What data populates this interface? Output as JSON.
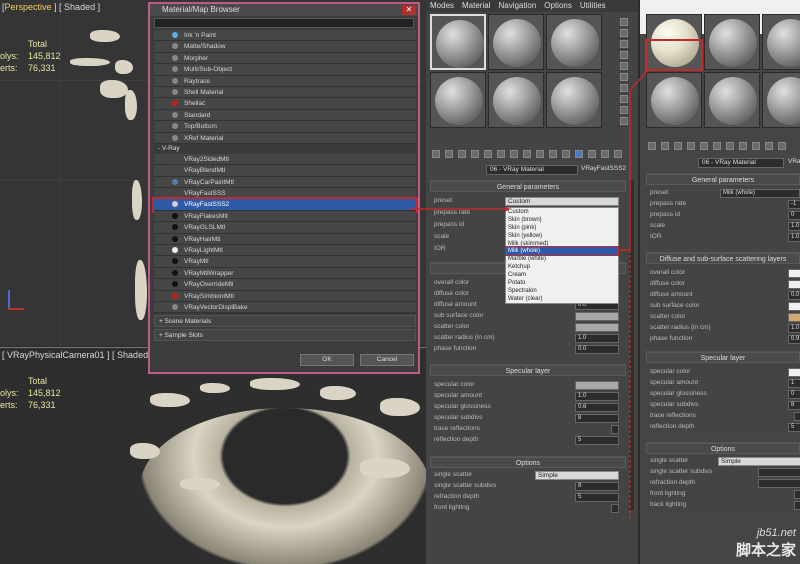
{
  "viewport_top": {
    "label_parts": [
      "[",
      "Perspective",
      " ] [ Shaded ]"
    ],
    "stats": {
      "total_label": "Total",
      "polys_label": "olys:",
      "polys": "145,812",
      "verts_label": "erts:",
      "verts": "76,331"
    }
  },
  "viewport_bottom": {
    "label": "[ VRayPhysicalCamera01 ] [ Shaded",
    "stats": {
      "total_label": "Total",
      "polys_label": "olys:",
      "polys": "145,812",
      "verts_label": "erts:",
      "verts": "76,331"
    }
  },
  "browser": {
    "title": "Material/Map Browser",
    "close": "✕",
    "standard_items": [
      {
        "label": "Ink 'n Paint",
        "icon": "material-icon",
        "color": "#5ab0e0"
      },
      {
        "label": "Matte/Shadow",
        "icon": "material-icon",
        "color": "#888888"
      },
      {
        "label": "Morpher",
        "icon": "material-icon",
        "color": "#888888"
      },
      {
        "label": "Multi/Sub-Object",
        "icon": "material-icon",
        "color": "#888888"
      },
      {
        "label": "Raytrace",
        "icon": "material-icon",
        "color": "#888888"
      },
      {
        "label": "Shell Material",
        "icon": "material-icon",
        "color": "#888888"
      },
      {
        "label": "Shellac",
        "icon": "material-icon",
        "color": "#c02020"
      },
      {
        "label": "Standard",
        "icon": "material-icon",
        "color": "#888888"
      },
      {
        "label": "Top/Bottom",
        "icon": "material-icon",
        "color": "#888888"
      },
      {
        "label": "XRef Material",
        "icon": "material-icon",
        "color": "#888888"
      }
    ],
    "vray_group": "- V-Ray",
    "vray_items": [
      {
        "label": "VRay2SidedMtl",
        "color": "#444444"
      },
      {
        "label": "VRayBlendMtl",
        "color": "#444444"
      },
      {
        "label": "VRayCarPaintMtl",
        "color": "#5a7aa8"
      },
      {
        "label": "VRayFastSSS",
        "color": "#444444"
      },
      {
        "label": "VRayFastSSS2",
        "color": "#d0d0d0",
        "selected": true
      },
      {
        "label": "VRayFlakesMtl",
        "color": "#111111"
      },
      {
        "label": "VRayGLSLMtl",
        "color": "#111111"
      },
      {
        "label": "VRayHairMtl",
        "color": "#111111"
      },
      {
        "label": "VRayLightMtl",
        "color": "#f0f0f0"
      },
      {
        "label": "VRayMtl",
        "color": "#111111"
      },
      {
        "label": "VRayMtlWrapper",
        "color": "#111111"
      },
      {
        "label": "VRayOverrideMtl",
        "color": "#111111"
      },
      {
        "label": "VRaySimbiontMtl",
        "color": "#c02020"
      },
      {
        "label": "VRayVectorDisplBake",
        "color": "#888888"
      }
    ],
    "scene_materials": "+ Scene Materials",
    "sample_slots": "+ Sample Slots",
    "ok": "OK",
    "cancel": "Cancel"
  },
  "editor": {
    "menu": [
      "Modes",
      "Material",
      "Navigation",
      "Options",
      "Utilities"
    ],
    "material_name": "06 - VRay Material",
    "material_type": "VRayFastSSS2",
    "general": {
      "title": "General parameters",
      "preset_label": "preset",
      "preset_value": "Custom",
      "rows": [
        "prepass rate",
        "prepass id",
        "scale",
        "IOR"
      ]
    },
    "preset_options": [
      "Custom",
      "Skin (brown)",
      "Skin (pink)",
      "Skin (yellow)",
      "Milk (skimmed)",
      "Milk (whole)",
      "Marble (white)",
      "Ketchup",
      "Cream",
      "Potato",
      "Spectralon",
      "Water (clear)"
    ],
    "preset_selected": "Milk (whole)",
    "diffuse": {
      "title": "Diffuse and s",
      "rows": [
        {
          "label": "overall color",
          "kind": "swatch"
        },
        {
          "label": "diffuse color",
          "kind": "swatch"
        },
        {
          "label": "diffuse amount",
          "value": "0.0"
        },
        {
          "label": "sub surface color",
          "kind": "swatch"
        },
        {
          "label": "scatter color",
          "kind": "swatch"
        },
        {
          "label": "scatter radius (in cm)",
          "value": "1.0"
        },
        {
          "label": "phase function",
          "value": "0.0"
        }
      ]
    },
    "specular": {
      "title": "Specular layer",
      "rows": [
        {
          "label": "specular color",
          "kind": "swatch"
        },
        {
          "label": "specular amount",
          "value": "1.0"
        },
        {
          "label": "specular glossiness",
          "value": "0.6"
        },
        {
          "label": "specular subdivs",
          "value": "8"
        },
        {
          "label": "trace reflections",
          "kind": "check"
        },
        {
          "label": "reflection depth",
          "value": "5"
        }
      ]
    },
    "options": {
      "title": "Options",
      "rows": [
        {
          "label": "single scatter",
          "value": "Simple",
          "kind": "dropdown"
        },
        {
          "label": "single scatter subdivs",
          "value": "8"
        },
        {
          "label": "refraction depth",
          "value": "5"
        },
        {
          "label": "front lighting",
          "kind": "check"
        }
      ]
    }
  },
  "editor2": {
    "material_name": "06 - VRay Material",
    "material_type": "VRay",
    "general": {
      "title": "General parameters",
      "preset_label": "preset",
      "preset_value": "Milk (whole)",
      "rows": [
        {
          "label": "prepass rate",
          "value": "-1"
        },
        {
          "label": "prepass id",
          "value": "0"
        },
        {
          "label": "scale",
          "value": "1.0"
        },
        {
          "label": "IOR",
          "value": "1.0"
        }
      ]
    },
    "diffuse": {
      "title": "Diffuse and sub-surface scattering layers",
      "rows": [
        {
          "label": "overall color",
          "kind": "swatch",
          "color": "#f0f0f0"
        },
        {
          "label": "diffuse color",
          "kind": "swatch",
          "color": "#f0f0f0"
        },
        {
          "label": "diffuse amount",
          "value": "0.0"
        },
        {
          "label": "sub surface color",
          "kind": "swatch",
          "color": "#f0f0f0"
        },
        {
          "label": "scatter color",
          "kind": "swatch",
          "color": "#d0a870"
        },
        {
          "label": "scatter radius (in cm)",
          "value": "1.0"
        },
        {
          "label": "phase function",
          "value": "0.9"
        }
      ]
    },
    "specular": {
      "title": "Specular layer",
      "rows": [
        {
          "label": "specular color",
          "kind": "swatch",
          "color": "#f0f0f0"
        },
        {
          "label": "specular amount",
          "value": "1"
        },
        {
          "label": "specular glossiness",
          "value": "0"
        },
        {
          "label": "specular subdivs",
          "value": "8"
        },
        {
          "label": "trace reflections",
          "kind": "check"
        },
        {
          "label": "reflection depth",
          "value": "5"
        }
      ]
    },
    "options": {
      "title": "Options",
      "rows": [
        {
          "label": "single scatter",
          "value": "Simple",
          "kind": "dropdown"
        },
        {
          "label": "single scatter subdivs",
          "value": ""
        },
        {
          "label": "refraction depth",
          "value": ""
        },
        {
          "label": "front lighting",
          "kind": "check"
        },
        {
          "label": "back lighting",
          "kind": "check"
        }
      ]
    }
  },
  "watermark": {
    "site": "jb51.net",
    "name": "脚本之家"
  },
  "colors": {
    "accent_red": "#c02a2a",
    "selection_blue": "#2f5aa8",
    "dialog_border": "#c05a8a"
  }
}
